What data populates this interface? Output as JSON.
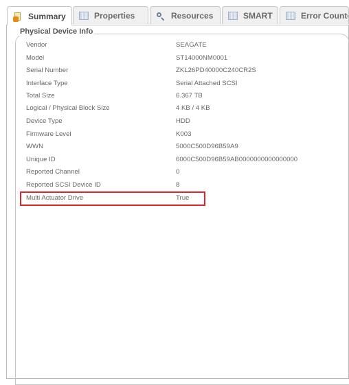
{
  "tabs": [
    {
      "label": "Summary",
      "icon": "summary-icon",
      "active": true
    },
    {
      "label": "Properties",
      "icon": "table-icon",
      "active": false
    },
    {
      "label": "Resources",
      "icon": "search-icon",
      "active": false
    },
    {
      "label": "SMART",
      "icon": "table-icon",
      "active": false
    },
    {
      "label": "Error Counter",
      "icon": "table-icon",
      "active": false
    }
  ],
  "section": {
    "title": "Physical Device Info",
    "rows": [
      {
        "key": "Vendor",
        "value": "SEAGATE"
      },
      {
        "key": "Model",
        "value": "ST14000NM0001"
      },
      {
        "key": "Serial Number",
        "value": "ZKL26PD40000C240CR2S"
      },
      {
        "key": "Interface Type",
        "value": "Serial Attached SCSI"
      },
      {
        "key": "Total Size",
        "value": "6.367 TB"
      },
      {
        "key": "Logical / Physical Block Size",
        "value": "4 KB / 4 KB"
      },
      {
        "key": "Device Type",
        "value": "HDD"
      },
      {
        "key": "Firmware Level",
        "value": "K003"
      },
      {
        "key": "WWN",
        "value": "5000C500D96B59A9"
      },
      {
        "key": "Unique ID",
        "value": "6000C500D96B59AB0000000000000000"
      },
      {
        "key": "Reported Channel",
        "value": "0"
      },
      {
        "key": "Reported SCSI Device ID",
        "value": "8"
      },
      {
        "key": "Multi Actuator Drive",
        "value": "True",
        "highlighted": true
      }
    ]
  },
  "colors": {
    "highlight_border": "#e0232b",
    "tab_active_bg": "#ffffff",
    "tab_inactive_bg": "#f0f0f0"
  }
}
